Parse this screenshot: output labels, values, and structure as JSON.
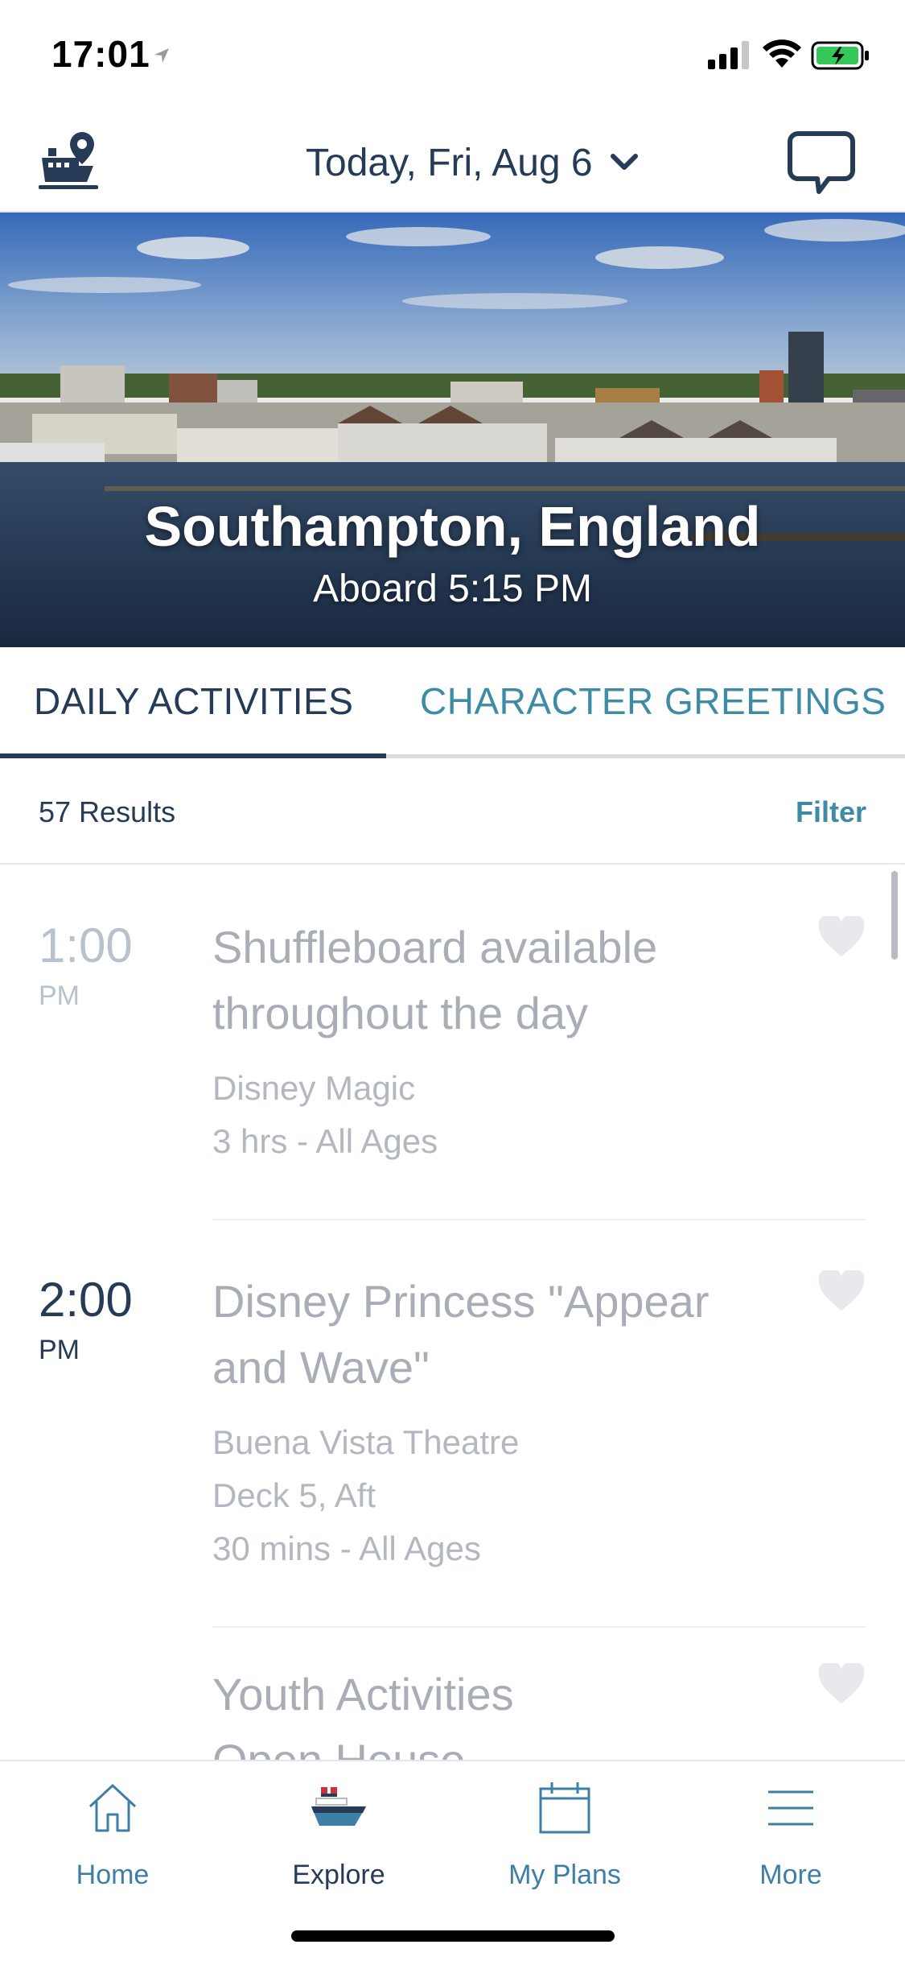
{
  "status_bar": {
    "time": "17:01",
    "icons": [
      "location-arrow-icon",
      "signal-icon",
      "wifi-icon",
      "battery-charging-icon"
    ]
  },
  "header": {
    "left_icon": "ship-pin-icon",
    "date_label": "Today, Fri, Aug 6",
    "right_icon": "chat-bubble-icon"
  },
  "hero": {
    "title": "Southampton, England",
    "subtitle": "Aboard 5:15 PM"
  },
  "tabs": [
    {
      "label": "DAILY ACTIVITIES",
      "active": true
    },
    {
      "label": "CHARACTER GREETINGS",
      "active": false
    }
  ],
  "results": {
    "count_label": "57 Results",
    "filter_label": "Filter"
  },
  "activities": [
    {
      "time": "1:00",
      "ampm": "PM",
      "title_lines": [
        "Shuffleboard available",
        "throughout the day"
      ],
      "details": [
        "Disney Magic",
        "3 hrs - All Ages"
      ]
    },
    {
      "time": "2:00",
      "ampm": "PM",
      "title_lines": [
        "Disney Princess \"Appear",
        "and Wave\""
      ],
      "details": [
        "Buena Vista Theatre",
        "Deck 5, Aft",
        "30 mins - All Ages"
      ]
    },
    {
      "time": "",
      "ampm": "",
      "title_lines": [
        "Youth Activities",
        "Open House"
      ],
      "details": []
    }
  ],
  "bottom_nav": [
    {
      "label": "Home",
      "icon": "home-icon",
      "active": false
    },
    {
      "label": "Explore",
      "icon": "cruise-ship-icon",
      "active": true
    },
    {
      "label": "My Plans",
      "icon": "calendar-icon",
      "active": false
    },
    {
      "label": "More",
      "icon": "menu-icon",
      "active": false
    }
  ],
  "colors": {
    "navy": "#253b56",
    "teal": "#3e8ba8",
    "muted": "#a8adb6",
    "past_time": "#b8c2cc"
  }
}
